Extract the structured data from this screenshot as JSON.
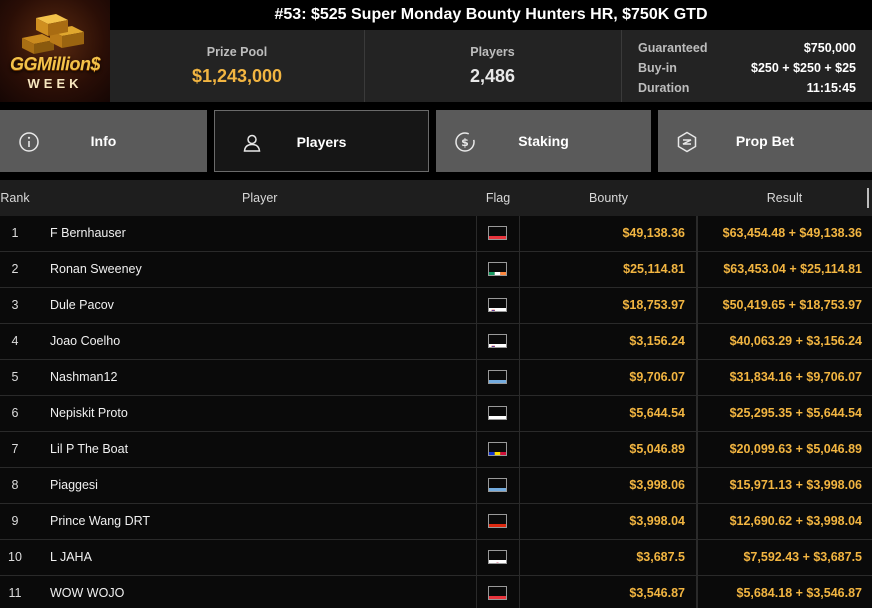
{
  "logo": {
    "line1": "GGMillion$",
    "line2": "WEEK"
  },
  "header": {
    "title": "#53: $525 Super Monday Bounty Hunters HR, $750K GTD"
  },
  "stats": {
    "prize_pool_label": "Prize Pool",
    "prize_pool_value": "$1,243,000",
    "players_label": "Players",
    "players_value": "2,486"
  },
  "details": {
    "guaranteed_label": "Guaranteed",
    "guaranteed_value": "$750,000",
    "buyin_label": "Buy-in",
    "buyin_value": "$250 + $250 + $25",
    "duration_label": "Duration",
    "duration_value": "11:15:45"
  },
  "tabs": [
    {
      "label": "Info",
      "icon": "info-icon",
      "active": false
    },
    {
      "label": "Players",
      "icon": "user-icon",
      "active": true
    },
    {
      "label": "Staking",
      "icon": "dollar-coin-icon",
      "active": false
    },
    {
      "label": "Prop Bet",
      "icon": "lightning-shield-icon",
      "active": false
    }
  ],
  "table": {
    "headers": {
      "rank": "Rank",
      "player": "Player",
      "flag": "Flag",
      "bounty": "Bounty",
      "result": "Result"
    },
    "rows": [
      {
        "rank": "1",
        "player": "F Bernhauser",
        "flag": "austria",
        "bounty": "$49,138.36",
        "result": "$63,454.48 + $49,138.36"
      },
      {
        "rank": "2",
        "player": "Ronan Sweeney",
        "flag": "ireland",
        "bounty": "$25,114.81",
        "result": "$63,453.04 + $25,114.81"
      },
      {
        "rank": "3",
        "player": "Dule Pacov",
        "flag": "slovenia",
        "bounty": "$18,753.97",
        "result": "$50,419.65 + $18,753.97"
      },
      {
        "rank": "4",
        "player": "Joao Coelho",
        "flag": "slovenia",
        "bounty": "$3,156.24",
        "result": "$40,063.29 + $3,156.24"
      },
      {
        "rank": "5",
        "player": "Nashman12",
        "flag": "argentina",
        "bounty": "$9,706.07",
        "result": "$31,834.16 + $9,706.07"
      },
      {
        "rank": "6",
        "player": "Nepiskit Proto",
        "flag": "cyprus",
        "bounty": "$5,644.54",
        "result": "$25,295.35 + $5,644.54"
      },
      {
        "rank": "7",
        "player": "Lil P The Boat",
        "flag": "andorra",
        "bounty": "$5,046.89",
        "result": "$20,099.63 + $5,046.89"
      },
      {
        "rank": "8",
        "player": "Piaggesi",
        "flag": "argentina",
        "bounty": "$3,998.06",
        "result": "$15,971.13 + $3,998.06"
      },
      {
        "rank": "9",
        "player": "Prince Wang DRT",
        "flag": "hong-kong",
        "bounty": "$3,998.04",
        "result": "$12,690.62 + $3,998.04"
      },
      {
        "rank": "10",
        "player": "L JAHA",
        "flag": "japan",
        "bounty": "$3,687.5",
        "result": "$7,592.43 + $3,687.5"
      },
      {
        "rank": "11",
        "player": "WOW WOJO",
        "flag": "austria",
        "bounty": "$3,546.87",
        "result": "$5,684.18 + $3,546.87"
      }
    ]
  },
  "colors": {
    "accent": "#f2b541",
    "tab_bg": "#5a5a5a",
    "tab_active_bg": "#161616",
    "stats_bg": "#232323"
  }
}
